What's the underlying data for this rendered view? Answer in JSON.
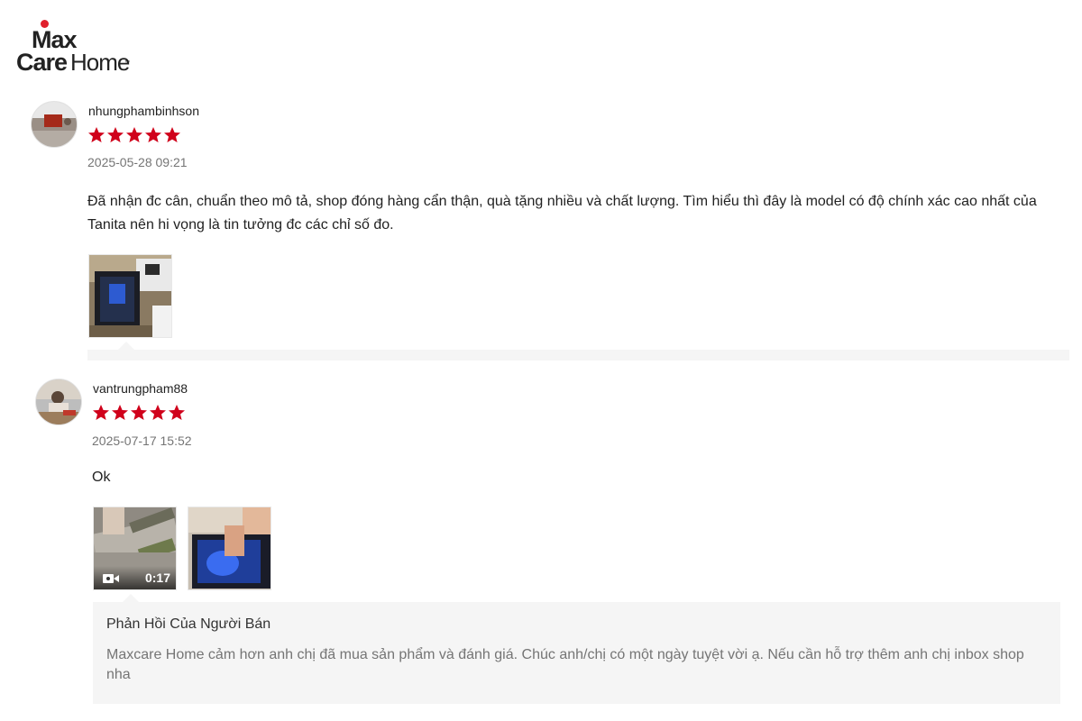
{
  "brand": {
    "logo_text_top": "Max",
    "logo_text_care": "Care",
    "logo_text_home": "Home",
    "logo_tm": "™",
    "accent_color": "#e0202c"
  },
  "reviews": [
    {
      "username": "nhungphambinhson",
      "rating": 5,
      "date": "2025-05-28 09:21",
      "comment": "Đã nhận đc cân, chuẩn theo mô tả, shop đóng hàng cẩn thận, quà tặng nhiều và chất lượng. Tìm hiểu thì đây là model có độ chính xác cao nhất của Tanita nên hi vọng là tin tưởng đc các chỉ số đo.",
      "media": [
        {
          "type": "image",
          "icon": "photo-thumbnail"
        }
      ]
    },
    {
      "username": "vantrungpham88",
      "rating": 5,
      "date": "2025-07-17 15:52",
      "comment": "Ok",
      "media": [
        {
          "type": "video",
          "icon": "video-camera-icon",
          "duration": "0:17"
        },
        {
          "type": "image",
          "icon": "photo-thumbnail"
        }
      ],
      "seller_reply": {
        "title": "Phản Hồi Của Người Bán",
        "text": "Maxcare Home cảm hơn anh chị đã mua sản phẩm và đánh giá. Chúc anh/chị có một ngày tuyệt vời ạ. Nếu cần hỗ trợ thêm anh chị inbox shop nha"
      }
    }
  ],
  "colors": {
    "star": "#d0011b",
    "date": "#757575",
    "reply_bg": "#f5f5f5"
  }
}
